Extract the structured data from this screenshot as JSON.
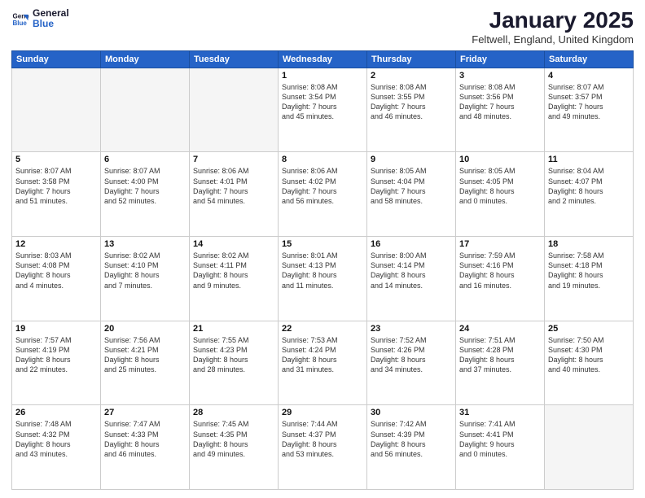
{
  "header": {
    "logo_line1": "General",
    "logo_line2": "Blue",
    "month_title": "January 2025",
    "location": "Feltwell, England, United Kingdom"
  },
  "weekdays": [
    "Sunday",
    "Monday",
    "Tuesday",
    "Wednesday",
    "Thursday",
    "Friday",
    "Saturday"
  ],
  "weeks": [
    [
      {
        "day": "",
        "info": ""
      },
      {
        "day": "",
        "info": ""
      },
      {
        "day": "",
        "info": ""
      },
      {
        "day": "1",
        "info": "Sunrise: 8:08 AM\nSunset: 3:54 PM\nDaylight: 7 hours\nand 45 minutes."
      },
      {
        "day": "2",
        "info": "Sunrise: 8:08 AM\nSunset: 3:55 PM\nDaylight: 7 hours\nand 46 minutes."
      },
      {
        "day": "3",
        "info": "Sunrise: 8:08 AM\nSunset: 3:56 PM\nDaylight: 7 hours\nand 48 minutes."
      },
      {
        "day": "4",
        "info": "Sunrise: 8:07 AM\nSunset: 3:57 PM\nDaylight: 7 hours\nand 49 minutes."
      }
    ],
    [
      {
        "day": "5",
        "info": "Sunrise: 8:07 AM\nSunset: 3:58 PM\nDaylight: 7 hours\nand 51 minutes."
      },
      {
        "day": "6",
        "info": "Sunrise: 8:07 AM\nSunset: 4:00 PM\nDaylight: 7 hours\nand 52 minutes."
      },
      {
        "day": "7",
        "info": "Sunrise: 8:06 AM\nSunset: 4:01 PM\nDaylight: 7 hours\nand 54 minutes."
      },
      {
        "day": "8",
        "info": "Sunrise: 8:06 AM\nSunset: 4:02 PM\nDaylight: 7 hours\nand 56 minutes."
      },
      {
        "day": "9",
        "info": "Sunrise: 8:05 AM\nSunset: 4:04 PM\nDaylight: 7 hours\nand 58 minutes."
      },
      {
        "day": "10",
        "info": "Sunrise: 8:05 AM\nSunset: 4:05 PM\nDaylight: 8 hours\nand 0 minutes."
      },
      {
        "day": "11",
        "info": "Sunrise: 8:04 AM\nSunset: 4:07 PM\nDaylight: 8 hours\nand 2 minutes."
      }
    ],
    [
      {
        "day": "12",
        "info": "Sunrise: 8:03 AM\nSunset: 4:08 PM\nDaylight: 8 hours\nand 4 minutes."
      },
      {
        "day": "13",
        "info": "Sunrise: 8:02 AM\nSunset: 4:10 PM\nDaylight: 8 hours\nand 7 minutes."
      },
      {
        "day": "14",
        "info": "Sunrise: 8:02 AM\nSunset: 4:11 PM\nDaylight: 8 hours\nand 9 minutes."
      },
      {
        "day": "15",
        "info": "Sunrise: 8:01 AM\nSunset: 4:13 PM\nDaylight: 8 hours\nand 11 minutes."
      },
      {
        "day": "16",
        "info": "Sunrise: 8:00 AM\nSunset: 4:14 PM\nDaylight: 8 hours\nand 14 minutes."
      },
      {
        "day": "17",
        "info": "Sunrise: 7:59 AM\nSunset: 4:16 PM\nDaylight: 8 hours\nand 16 minutes."
      },
      {
        "day": "18",
        "info": "Sunrise: 7:58 AM\nSunset: 4:18 PM\nDaylight: 8 hours\nand 19 minutes."
      }
    ],
    [
      {
        "day": "19",
        "info": "Sunrise: 7:57 AM\nSunset: 4:19 PM\nDaylight: 8 hours\nand 22 minutes."
      },
      {
        "day": "20",
        "info": "Sunrise: 7:56 AM\nSunset: 4:21 PM\nDaylight: 8 hours\nand 25 minutes."
      },
      {
        "day": "21",
        "info": "Sunrise: 7:55 AM\nSunset: 4:23 PM\nDaylight: 8 hours\nand 28 minutes."
      },
      {
        "day": "22",
        "info": "Sunrise: 7:53 AM\nSunset: 4:24 PM\nDaylight: 8 hours\nand 31 minutes."
      },
      {
        "day": "23",
        "info": "Sunrise: 7:52 AM\nSunset: 4:26 PM\nDaylight: 8 hours\nand 34 minutes."
      },
      {
        "day": "24",
        "info": "Sunrise: 7:51 AM\nSunset: 4:28 PM\nDaylight: 8 hours\nand 37 minutes."
      },
      {
        "day": "25",
        "info": "Sunrise: 7:50 AM\nSunset: 4:30 PM\nDaylight: 8 hours\nand 40 minutes."
      }
    ],
    [
      {
        "day": "26",
        "info": "Sunrise: 7:48 AM\nSunset: 4:32 PM\nDaylight: 8 hours\nand 43 minutes."
      },
      {
        "day": "27",
        "info": "Sunrise: 7:47 AM\nSunset: 4:33 PM\nDaylight: 8 hours\nand 46 minutes."
      },
      {
        "day": "28",
        "info": "Sunrise: 7:45 AM\nSunset: 4:35 PM\nDaylight: 8 hours\nand 49 minutes."
      },
      {
        "day": "29",
        "info": "Sunrise: 7:44 AM\nSunset: 4:37 PM\nDaylight: 8 hours\nand 53 minutes."
      },
      {
        "day": "30",
        "info": "Sunrise: 7:42 AM\nSunset: 4:39 PM\nDaylight: 8 hours\nand 56 minutes."
      },
      {
        "day": "31",
        "info": "Sunrise: 7:41 AM\nSunset: 4:41 PM\nDaylight: 9 hours\nand 0 minutes."
      },
      {
        "day": "",
        "info": ""
      }
    ]
  ]
}
